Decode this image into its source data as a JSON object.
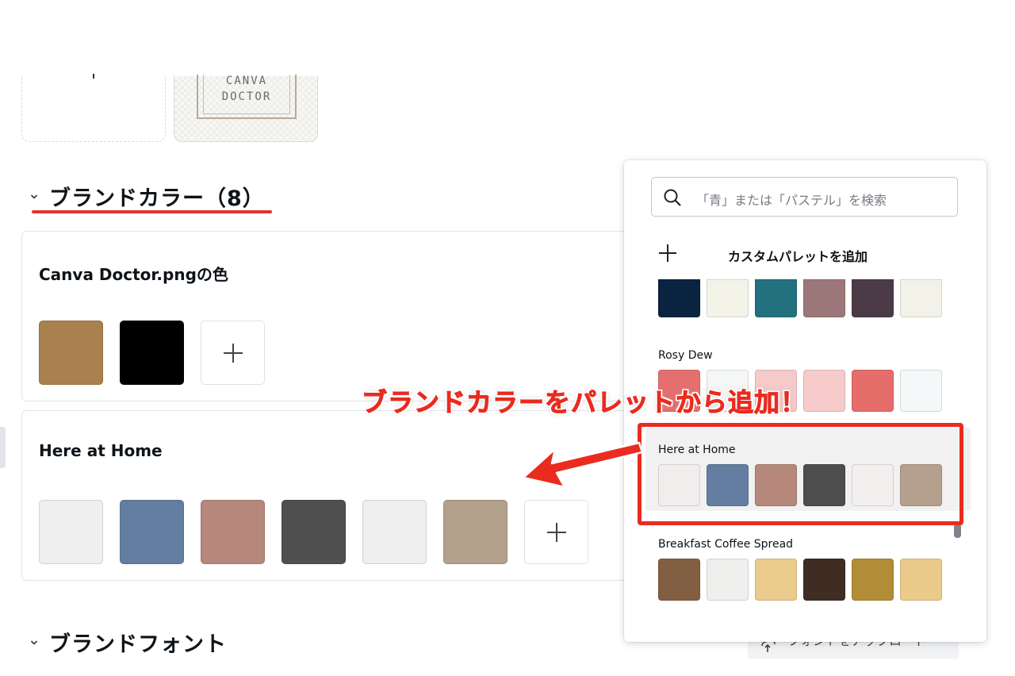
{
  "logos": {
    "canva_logo_line1": "CANVA",
    "canva_logo_line2": "DOCTOR"
  },
  "brand_colors": {
    "title": "ブランドカラー（8）",
    "palettes": [
      {
        "name": "Canva Doctor.pngの色",
        "swatches": [
          "#a8814f",
          "#000000"
        ]
      },
      {
        "name": "Here at Home",
        "swatches": [
          "#f0efef",
          "#637ea0",
          "#b5887b",
          "#4f4f4f",
          "#efeeee",
          "#b3a08b"
        ]
      }
    ]
  },
  "brand_fonts": {
    "title": "ブランドフォント"
  },
  "dropdown": {
    "search_placeholder": "「青」または「パステル」を検索",
    "add_custom_label": "カスタムパレットを追加",
    "first_palette_swatches": [
      "#0a2340",
      "#f3f3e8",
      "#23707f",
      "#9c777a",
      "#4a3b46",
      "#f3f2e8"
    ],
    "palettes": [
      {
        "name": "Rosy Dew",
        "swatches": [
          "#e56f6f",
          "#f5f7f6",
          "#f6caca",
          "#f7cbcb",
          "#e56e6b",
          "#f5f8f8"
        ]
      },
      {
        "name": "Here at Home",
        "swatches": [
          "#f0edec",
          "#637ea0",
          "#b5887b",
          "#4d4d4e",
          "#f2efee",
          "#b4a08c"
        ]
      },
      {
        "name": "Breakfast Coffee Spread",
        "swatches": [
          "#825f42",
          "#efefee",
          "#ebcb8e",
          "#3f2c23",
          "#b28c36",
          "#ebcb8b"
        ]
      }
    ]
  },
  "annotation": {
    "callout_text": "ブランドカラーをパレットから追加！",
    "accent_color": "#ea2b1f"
  },
  "upload_button": {
    "label": "フォントをアップロード"
  }
}
